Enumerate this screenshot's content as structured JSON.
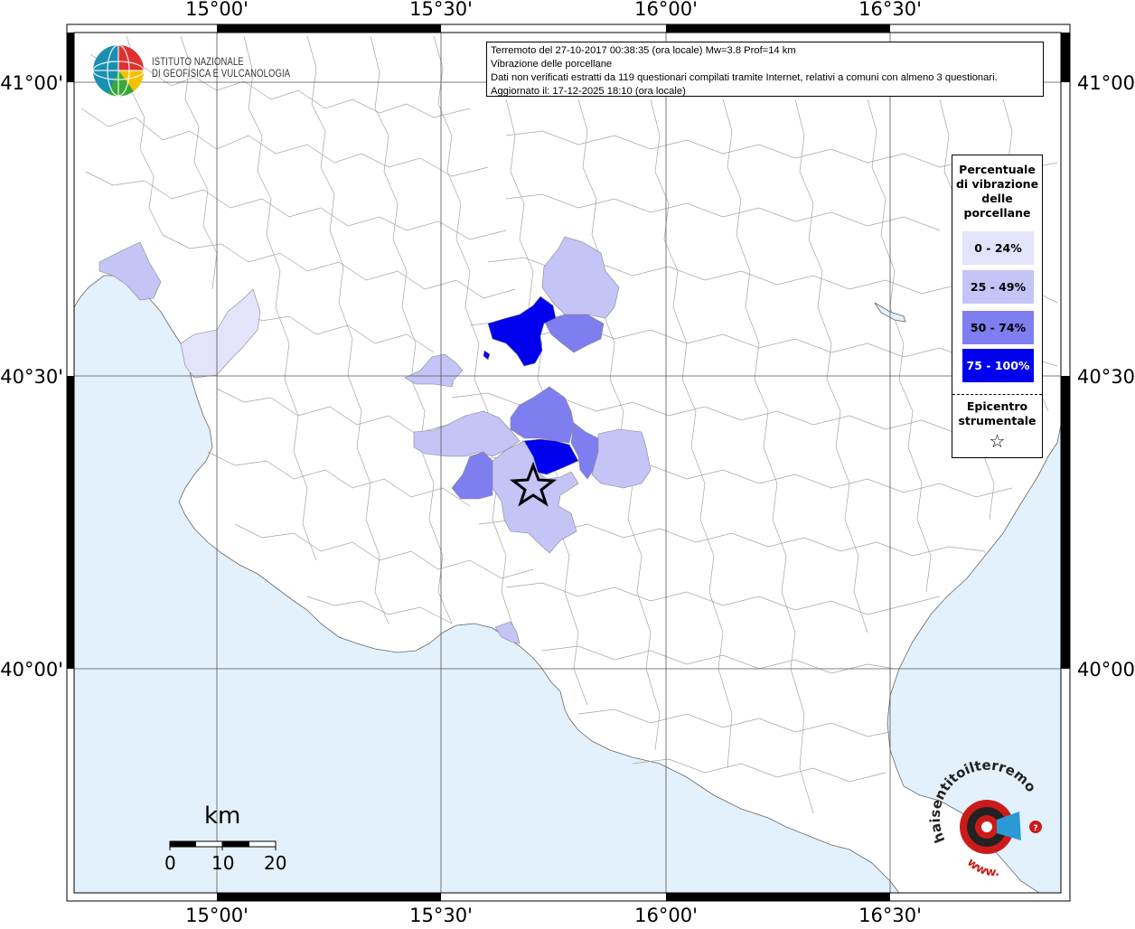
{
  "info": {
    "line1": "Terremoto del 27-10-2017 00:38:35 (ora locale) Mw=3.8 Prof=14 km",
    "line2": "Vibrazione delle porcellane",
    "line3": "Dati non verificati estratti da 119 questionari compilati tramite Internet, relativi a comuni con almeno 3 questionari.",
    "line4": "Aggiornato il: 17-12-2025 18:10 (ora locale)"
  },
  "logo": {
    "line1": "ISTITUTO NAZIONALE",
    "line2": "DI GEOFISICA E VULCANOLOGIA"
  },
  "axes": {
    "top": [
      "15°00'",
      "15°30'",
      "16°00'",
      "16°30'"
    ],
    "bottom": [
      "15°00'",
      "15°30'",
      "16°00'",
      "16°30'"
    ],
    "left": [
      "41°00'",
      "40°30'",
      "40°00'"
    ],
    "right": [
      "41°00'",
      "40°30'",
      "40°00'"
    ]
  },
  "legend": {
    "title_lines": [
      "Percentuale",
      "di vibrazione",
      "delle",
      "porcellane"
    ],
    "classes": [
      {
        "label": "0 - 24%",
        "color": "#e3e3fb",
        "text_color": "#000000"
      },
      {
        "label": "25 - 49%",
        "color": "#c4c4f7",
        "text_color": "#000000"
      },
      {
        "label": "50 - 74%",
        "color": "#7e7ef0",
        "text_color": "#000000"
      },
      {
        "label": "75 - 100%",
        "color": "#0000ee",
        "text_color": "#ffffff"
      }
    ],
    "epicenter_lines": [
      "Epicentro",
      "strumentale"
    ],
    "epicenter_symbol": "☆"
  },
  "scale": {
    "unit": "km",
    "labels": [
      "0",
      "10",
      "20"
    ]
  },
  "watermark": {
    "text_top": "haisentitoilterremoto.it",
    "text_bottom": "www."
  },
  "colors": {
    "sea": "#e2f1fc",
    "land": "#ffffff",
    "borders": "#9a9a9a",
    "grid": "#555555"
  }
}
